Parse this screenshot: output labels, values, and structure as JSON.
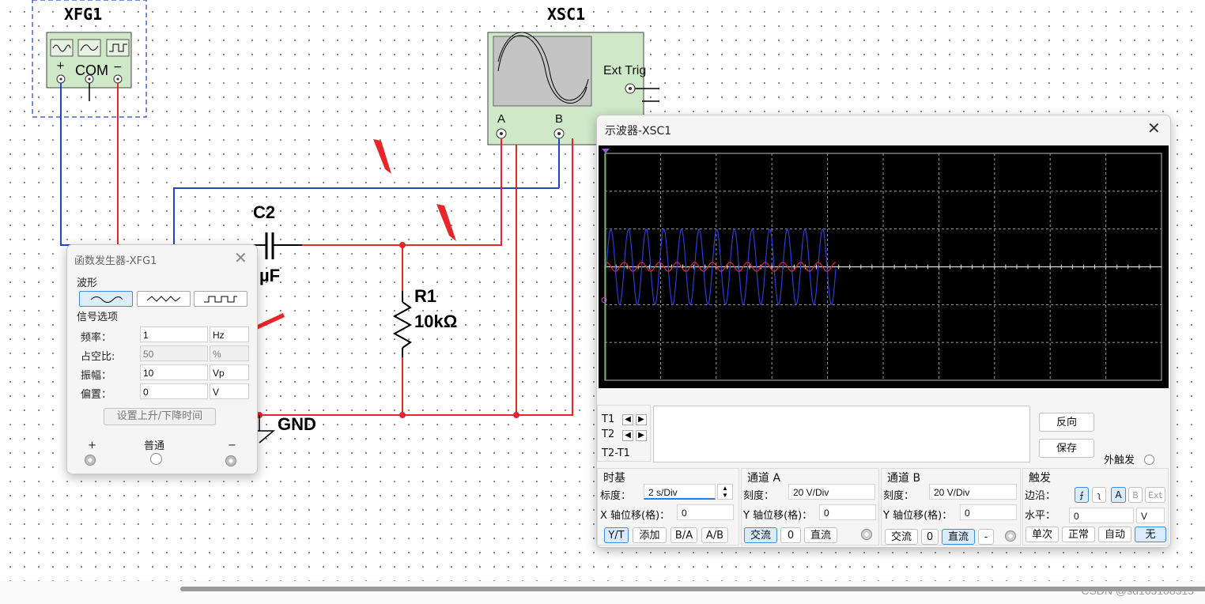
{
  "schematic": {
    "xfg1_label": "XFG1",
    "xfg1_terminals": {
      "plus": "+",
      "com": "COM",
      "minus": "−"
    },
    "xsc1_label": "XSC1",
    "xsc1_ext_trig": "Ext Trig",
    "xsc1_channel_a": "A",
    "xsc1_channel_b": "B",
    "c2_label": "C2",
    "c2_value": "µF",
    "r1_label": "R1",
    "r1_value": "10kΩ",
    "gnd_label": "GND"
  },
  "function_generator": {
    "title": "函数发生器-XFG1",
    "waveform_section": "波形",
    "signal_options_section": "信号选项",
    "frequency_label": "频率：",
    "frequency_value": "1",
    "frequency_unit": "Hz",
    "duty_label": "占空比:",
    "duty_value": "50",
    "duty_unit": "%",
    "amplitude_label": "振幅：",
    "amplitude_value": "10",
    "amplitude_unit": "Vp",
    "offset_label": "偏置：",
    "offset_value": "0",
    "offset_unit": "V",
    "rise_fall_button": "设置上升/下降时间",
    "terminal_plus": "+",
    "terminal_common": "普通",
    "terminal_minus": "−",
    "selected_waveform": "sine"
  },
  "oscilloscope": {
    "title": "示波器-XSC1",
    "cursor_t1": "T1",
    "cursor_t2": "T2",
    "cursor_diff": "T2-T1",
    "reverse_button": "反向",
    "save_button": "保存",
    "ext_trigger_label": "外触发",
    "timebase": {
      "title": "时基",
      "scale_label": "标度：",
      "scale_value": "2  s/Div",
      "x_offset_label": "X 轴位移(格)：",
      "x_offset_value": "0",
      "buttons": [
        "Y/T",
        "添加",
        "B/A",
        "A/B"
      ],
      "active": "Y/T"
    },
    "channel_a": {
      "title": "通道 A",
      "scale_label": "刻度：",
      "scale_value": "20  V/Div",
      "y_offset_label": "Y 轴位移(格)：",
      "y_offset_value": "0",
      "buttons": [
        "交流",
        "0",
        "直流"
      ],
      "active": "交流"
    },
    "channel_b": {
      "title": "通道 B",
      "scale_label": "刻度：",
      "scale_value": "20  V/Div",
      "y_offset_label": "Y 轴位移(格)：",
      "y_offset_value": "0",
      "buttons": [
        "交流",
        "0",
        "直流",
        "-"
      ],
      "active": "直流"
    },
    "trigger": {
      "title": "触发",
      "edge_label": "边沿：",
      "level_label": "水平：",
      "level_value": "0",
      "level_unit": "V",
      "source_buttons": [
        "A",
        "B",
        "Ext"
      ],
      "active_source": "A",
      "mode_buttons": [
        "单次",
        "正常",
        "自动",
        "无"
      ],
      "active_mode": "无"
    },
    "screen": {
      "channel_a_color": "#e8262a",
      "channel_b_color": "#2a3cd8",
      "channel_b_cycles": 13,
      "channel_b_amplitude_div": 1,
      "channel_a_amplitude_div": 0.03
    }
  },
  "colors": {
    "wire_red": "#e8262a",
    "wire_blue": "#2244c8",
    "annotation_arrow": "#e8262a",
    "instrument_green": "#cfe8c8"
  },
  "watermark": "CSDN @su165108515"
}
